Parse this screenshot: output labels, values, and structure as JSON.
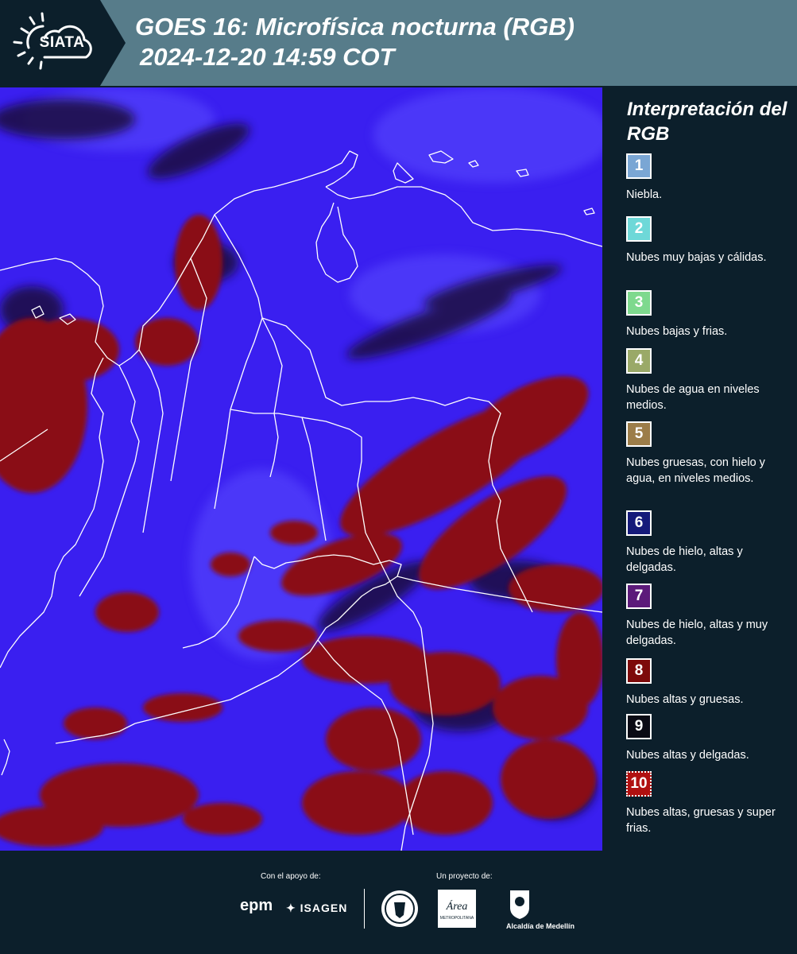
{
  "header": {
    "logo_text": "SIATA",
    "title_line1": "GOES 16: Microfísica nocturna (RGB)",
    "title_line2": "2024-12-20 14:59 COT"
  },
  "map": {
    "colors": {
      "background": "#3a1ff0",
      "thick_cloud": "#8a0f12",
      "thin_cloud": "#1a0c3c",
      "borders": "#ffffff"
    }
  },
  "legend": {
    "title": "Interpretación del RGB",
    "items": [
      {
        "number": "1",
        "label": "Niebla.",
        "color": "#7aa6d4"
      },
      {
        "number": "2",
        "label": "Nubes muy bajas y cálidas.",
        "color": "#6ed8d8"
      },
      {
        "number": "3",
        "label": "Nubes bajas y frias.",
        "color": "#7ed98e"
      },
      {
        "number": "4",
        "label": "Nubes de agua en niveles medios.",
        "color": "#9aa968"
      },
      {
        "number": "5",
        "label": "Nubes gruesas, con hielo y agua, en niveles medios.",
        "color": "#9c7d49"
      },
      {
        "number": "6",
        "label": "Nubes de hielo, altas y delgadas.",
        "color": "#151a7a"
      },
      {
        "number": "7",
        "label": "Nubes de hielo, altas y muy delgadas.",
        "color": "#5c1a7a"
      },
      {
        "number": "8",
        "label": "Nubes altas y gruesas.",
        "color": "#7d0a0a"
      },
      {
        "number": "9",
        "label": "Nubes altas y delgadas.",
        "color": "#0a0a14"
      },
      {
        "number": "10",
        "label": "Nubes altas, gruesas y super frias.",
        "color": "#b01010"
      }
    ]
  },
  "footer": {
    "support_label": "Con el apoyo de:",
    "project_label": "Un proyecto de:",
    "epm": "epm",
    "isagen": "ISAGEN",
    "area_name": "Área",
    "area_subtitle": "METROPOLITANA",
    "alcaldia": "Alcaldía de Medellín"
  }
}
